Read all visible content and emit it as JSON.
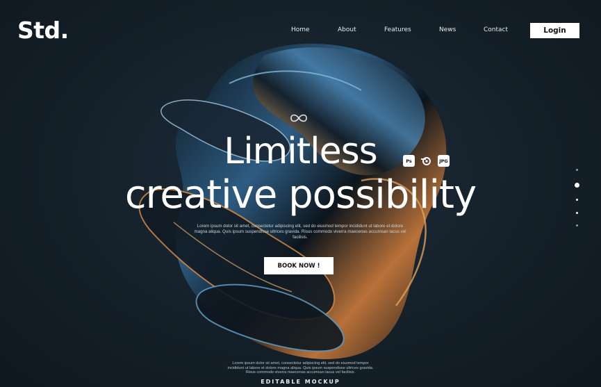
{
  "header": {
    "logo": "Std.",
    "nav": [
      "Home",
      "About",
      "Features",
      "News",
      "Contact"
    ],
    "login_label": "Login"
  },
  "hero": {
    "headline_line1": "Limitless",
    "headline_line2": "creative possibility",
    "badges": [
      "Ps",
      "Blender",
      "JPG"
    ],
    "description": "Lorem ipsum dolor sit amet, consectetur adipiscing elit, sed do eiusmod tempor incididunt ut labore et dolore magna aliqua. Quis ipsum suspendisse ultrices gravida. Risus commodo viverra maecenas accumsan lacus vel facilisis.",
    "cta_label": "BOOK NOW !"
  },
  "slider": {
    "dot_count": 5,
    "active_index": 1
  },
  "footer": {
    "text": "Lorem ipsum dolor sit amet, consectetur adipiscing elit, sed do eiusmod tempor incididunt ut labore et dolore magna aliqua. Quis ipsum suspendisse ultrices gravida. Risus commodo viverra maecenas accumsan lacus vel facilisis.",
    "label": "EDITABLE MOCKUP"
  },
  "colors": {
    "background": "#142029",
    "accent_blue": "#3d7fb0",
    "accent_orange": "#e59a4a",
    "button": "#ffffff"
  }
}
